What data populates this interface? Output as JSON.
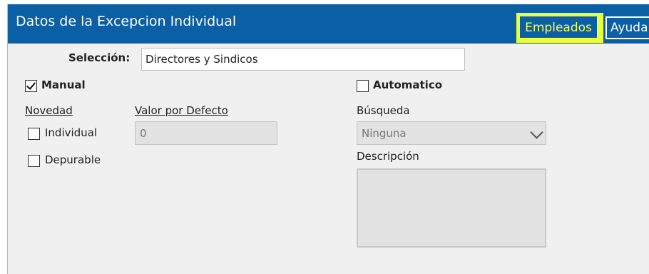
{
  "header": {
    "title": "Datos de la Excepcion Individual",
    "empleados_label": "Empleados",
    "ayuda_label": "Ayuda",
    "highlight_color": "#e8ff3b",
    "bar_color": "#0b5fa5"
  },
  "seleccion": {
    "label": "Selección:",
    "value": "Directores y Sindicos"
  },
  "manual": {
    "label": "Manual",
    "checked": true
  },
  "automatico": {
    "label": "Automatico",
    "checked": false
  },
  "novedad": {
    "header": "Novedad",
    "individual_label": "Individual",
    "depurable_label": "Depurable"
  },
  "valor_defecto": {
    "header": "Valor por Defecto",
    "value": "0"
  },
  "busqueda": {
    "label": "Búsqueda",
    "selected": "Ninguna"
  },
  "descripcion": {
    "label": "Descripción",
    "value": ""
  }
}
